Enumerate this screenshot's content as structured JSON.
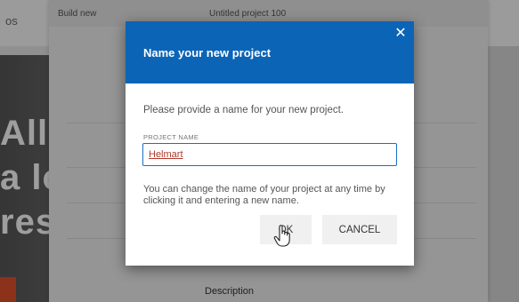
{
  "background": {
    "logo_text": "os",
    "modal_title_left": "Build new",
    "modal_title_right": "Untitled project 100",
    "hero_lines": [
      "All",
      "a lo",
      "res"
    ],
    "description_label": "Description"
  },
  "dialog": {
    "title": "Name your new project",
    "close_glyph": "✕",
    "prompt": "Please provide a name for your new project.",
    "field_label": "PROJECT NAME",
    "project_name_value": "Helmart",
    "note": "You can change the name of your project at any time by clicking it and entering a new name.",
    "ok_label": "OK",
    "cancel_label": "CANCEL"
  },
  "colors": {
    "header_blue": "#0c64b6",
    "overlay": "rgba(0,0,0,0.38)",
    "accent_orange": "#e2512a"
  },
  "icons": {
    "close": "close-icon",
    "cursor": "hand-pointer-cursor-icon"
  }
}
